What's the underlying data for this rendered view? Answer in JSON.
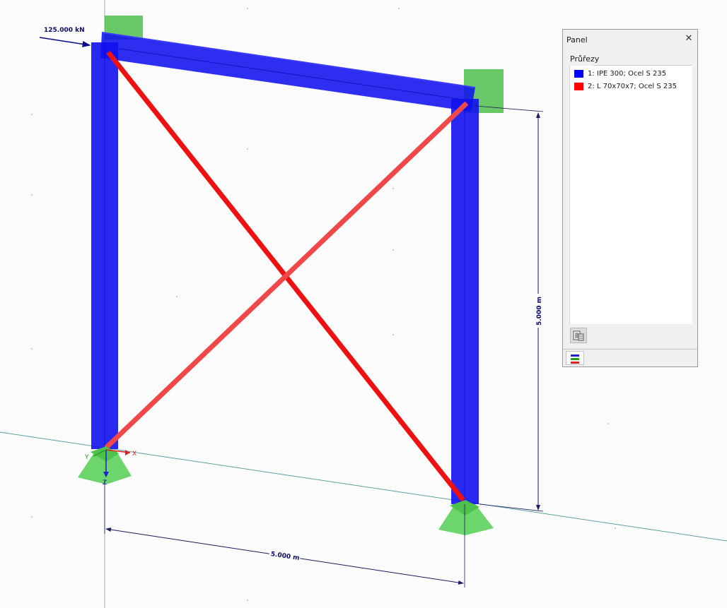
{
  "viewport": {
    "load_label": "125.000 kN",
    "height_dim_label": "5.000 m",
    "width_dim_label": "5.000 m",
    "axes": {
      "x": "X",
      "y": "Y",
      "z": "Z"
    }
  },
  "panel": {
    "title": "Panel",
    "close_glyph": "✕",
    "section_title": "Průřezy",
    "legend": [
      {
        "label": "1: IPE 300; Ocel S 235",
        "color": "#0000ff"
      },
      {
        "label": "2: L 70x70x7; Ocel S 235",
        "color": "#ff0000"
      }
    ]
  }
}
